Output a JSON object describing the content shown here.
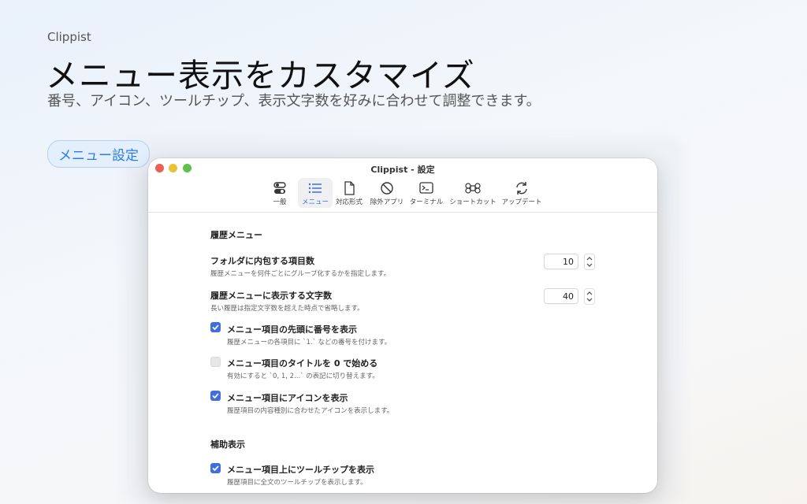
{
  "hero": {
    "app_name": "Clippist",
    "title": "メニュー表示をカスタマイズ",
    "subtitle": "番号、アイコン、ツールチップ、表示文字数を好みに合わせて調整できます。",
    "chip": "メニュー設定"
  },
  "window": {
    "title": "Clippist - 設定",
    "tabs": [
      {
        "label": "一般",
        "icon": "toggles-icon",
        "active": false
      },
      {
        "label": "メニュー",
        "icon": "list-icon",
        "active": true
      },
      {
        "label": "対応形式",
        "icon": "document-icon",
        "active": false
      },
      {
        "label": "除外アプリ",
        "icon": "prohibited-icon",
        "active": false
      },
      {
        "label": "ターミナル",
        "icon": "terminal-icon",
        "active": false
      },
      {
        "label": "ショートカット",
        "icon": "command-icon",
        "active": false
      },
      {
        "label": "アップデート",
        "icon": "refresh-icon",
        "active": false
      }
    ]
  },
  "settings": {
    "history_section": "履歴メニュー",
    "folder_count": {
      "label": "フォルダに内包する項目数",
      "desc": "履歴メニューを何件ごとにグループ化するかを指定します。",
      "value": "10"
    },
    "display_chars": {
      "label": "履歴メニューに表示する文字数",
      "desc": "長い履歴は指定文字数を超えた時点で省略します。",
      "value": "40"
    },
    "checkboxes": [
      {
        "label": "メニュー項目の先頭に番号を表示",
        "desc": "履歴メニューの各項目に `1.` などの番号を付けます。",
        "checked": true
      },
      {
        "label": "メニュー項目のタイトルを 0 で始める",
        "desc": "有効にすると `0, 1, 2...` の表記に切り替えます。",
        "checked": false
      },
      {
        "label": "メニュー項目にアイコンを表示",
        "desc": "履歴項目の内容種別に合わせたアイコンを表示します。",
        "checked": true
      }
    ],
    "aux_section": "補助表示",
    "tooltip": {
      "label": "メニュー項目上にツールチップを表示",
      "desc": "履歴項目に全文のツールチップを表示します。",
      "checked": true
    }
  },
  "colors": {
    "accent": "#3e6ee0",
    "chip_text": "#2c7be5"
  }
}
